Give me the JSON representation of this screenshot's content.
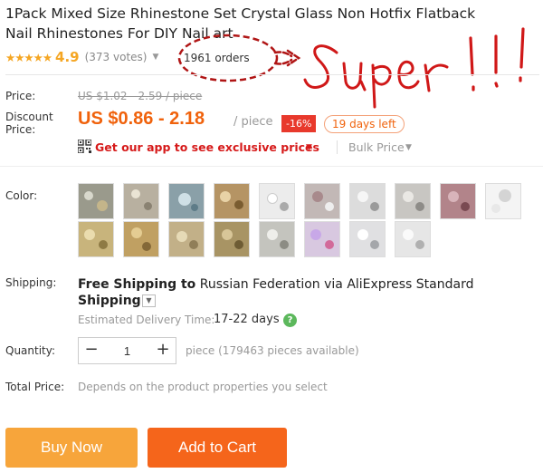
{
  "product": {
    "title": "1Pack Mixed Size Rhinestone Set Crystal Glass Non Hotfix Flatback Nail Rhinestones For DIY Nail art",
    "stars": "★★★★★",
    "rating": "4.9",
    "votes": "(373 votes)",
    "orders": "1961 orders"
  },
  "annotation": {
    "text": "Super!!!",
    "color": "#d01818"
  },
  "price": {
    "label": "Price:",
    "original": "US $1.02 - 2.59 / piece",
    "discount_label": "Discount Price:",
    "discount": "US $0.86 - 2.18",
    "unit": "/ piece",
    "percent_off": "-16%",
    "days_left": "19 days left",
    "app_promo": "Get our app to see exclusive prices",
    "bulk": "Bulk Price"
  },
  "color": {
    "label": "Color:"
  },
  "shipping": {
    "label": "Shipping:",
    "free_text": "Free Shipping to",
    "destination": "Russian Federation via AliExpress Standard",
    "method_tail": "Shipping",
    "est_label": "Estimated Delivery Time:",
    "est_value": "17-22 days"
  },
  "quantity": {
    "label": "Quantity:",
    "value": "1",
    "available": "piece (179463 pieces available)"
  },
  "total": {
    "label": "Total Price:",
    "value": "Depends on the product properties you select"
  },
  "buttons": {
    "buy": "Buy Now",
    "cart": "Add to Cart"
  },
  "colors": {
    "accent": "#f0620c",
    "sale_badge": "#e8392c",
    "buy_button": "#f7a53b",
    "cart_button": "#f5651b",
    "star": "#f5a623",
    "app_link": "#d61a1a"
  }
}
